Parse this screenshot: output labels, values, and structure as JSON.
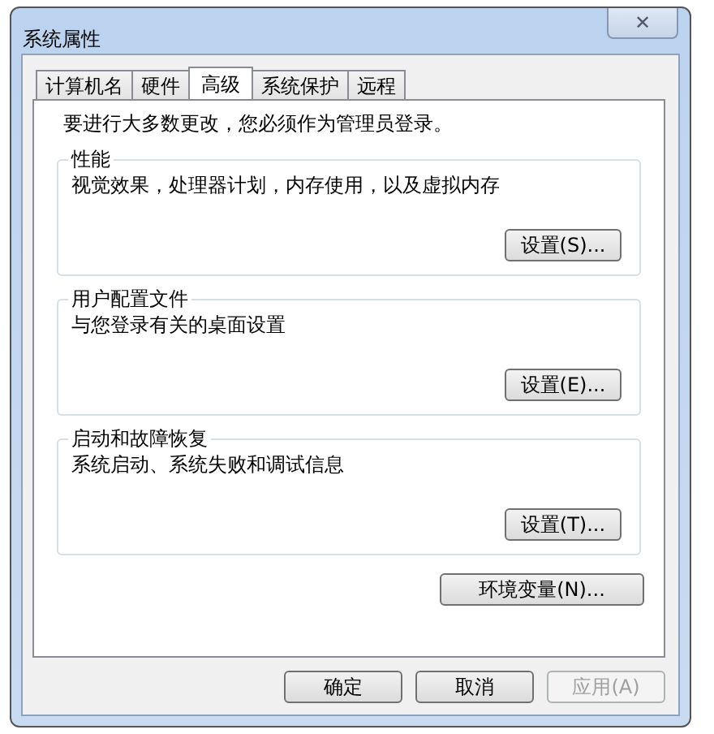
{
  "window": {
    "title": "系统属性",
    "close": "✕"
  },
  "tabs": [
    {
      "label": "计算机名",
      "selected": false
    },
    {
      "label": "硬件",
      "selected": false
    },
    {
      "label": "高级",
      "selected": true
    },
    {
      "label": "系统保护",
      "selected": false
    },
    {
      "label": "远程",
      "selected": false
    }
  ],
  "notice": "要进行大多数更改，您必须作为管理员登录。",
  "groups": [
    {
      "title": "性能",
      "description": "视觉效果，处理器计划，内存使用，以及虚拟内存",
      "button": "设置(S)..."
    },
    {
      "title": "用户配置文件",
      "description": "与您登录有关的桌面设置",
      "button": "设置(E)..."
    },
    {
      "title": "启动和故障恢复",
      "description": "系统启动、系统失败和调试信息",
      "button": "设置(T)..."
    }
  ],
  "env_button": "环境变量(N)...",
  "buttons": [
    {
      "label": "确定",
      "disabled": false
    },
    {
      "label": "取消",
      "disabled": false
    },
    {
      "label": "应用(A)",
      "disabled": true
    }
  ]
}
